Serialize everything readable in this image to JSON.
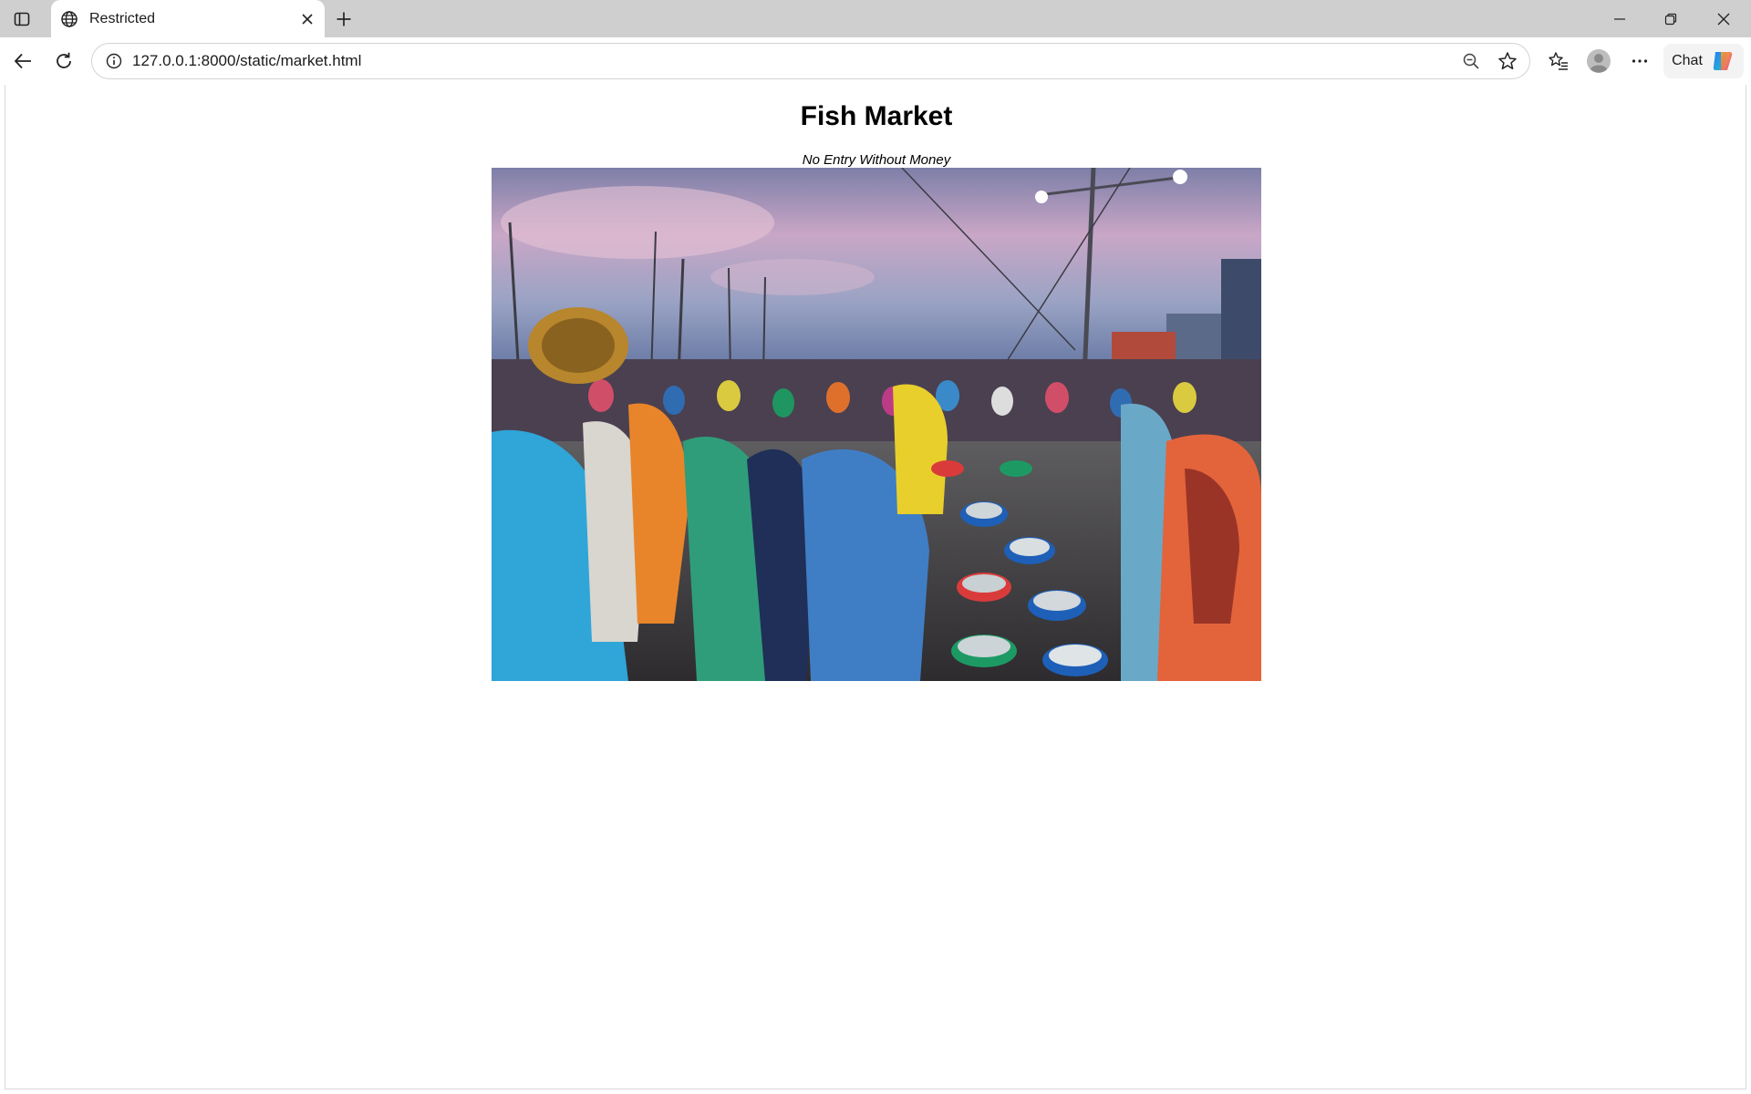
{
  "browser": {
    "tab": {
      "title": "Restricted",
      "icon": "globe-icon"
    },
    "address_bar": {
      "url": "127.0.0.1:8000/static/market.html"
    },
    "chat_label": "Chat"
  },
  "page": {
    "title": "Fish Market",
    "caption": "No Entry Without Money",
    "image": {
      "subject": "fish-market-photo",
      "accent_colors": [
        "#b89ec9",
        "#6b7aa8",
        "#2f6fb8",
        "#e8732a",
        "#1d9a64"
      ]
    }
  }
}
